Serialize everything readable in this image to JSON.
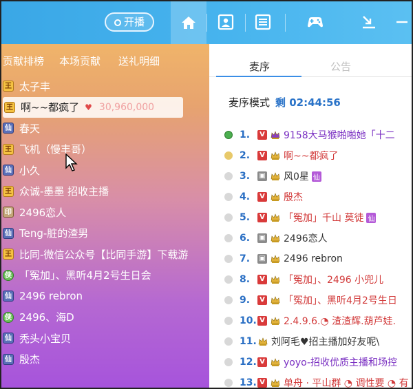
{
  "topbar": {
    "open_label": "开播",
    "icons": [
      "home-icon",
      "contact-card-icon",
      "list-icon",
      "gamepad-icon",
      "download-icon"
    ]
  },
  "left": {
    "tabs": [
      "贡献排榜",
      "本场贡献",
      "送礼明细"
    ],
    "rows": [
      {
        "badge": "王",
        "type": "king",
        "name": "太子丰"
      },
      {
        "badge": "王",
        "type": "king",
        "name": "啊~~都疯了",
        "amount": "30,960,000",
        "highlight": true
      },
      {
        "badge": "仙",
        "type": "shield",
        "name": "春天"
      },
      {
        "badge": "王",
        "type": "king",
        "name": "飞机（慢丰哥）"
      },
      {
        "badge": "仙",
        "type": "shield",
        "name": "小久"
      },
      {
        "badge": "王",
        "type": "king",
        "name": "众诚-墨墨 招收主播"
      },
      {
        "badge": "印",
        "type": "seal",
        "name": "2496恋人"
      },
      {
        "badge": "仙",
        "type": "shield",
        "name": "Teng-脏的渣男"
      },
      {
        "badge": "王",
        "type": "king",
        "name": "比同-微信公众号【比同手游】下载游"
      },
      {
        "badge": "侠",
        "type": "green",
        "name": "「冤加」、黑听4月2号生日会"
      },
      {
        "badge": "仙",
        "type": "shield",
        "name": "2496 rebron"
      },
      {
        "badge": "侠",
        "type": "green",
        "name": "2496、海D"
      },
      {
        "badge": "仙",
        "type": "shield",
        "name": "秃头小宝贝"
      },
      {
        "badge": "仙",
        "type": "shield",
        "name": "殷杰"
      }
    ]
  },
  "right": {
    "tabs": [
      "麦序",
      "公告"
    ],
    "mode_label": "麦序模式",
    "time_label": "剩 02:44:56",
    "rows": [
      {
        "num": "1.",
        "status": "active",
        "v": "V",
        "name": "9158大马猴啪啪她「十二",
        "color": "purple"
      },
      {
        "num": "2.",
        "status": "gold",
        "v": "V",
        "name": "啊~~都疯了",
        "color": "red"
      },
      {
        "num": "3.",
        "status": "none",
        "v": "▣",
        "name": "风0星",
        "color": "dark",
        "tag": "仙"
      },
      {
        "num": "4.",
        "status": "none",
        "v": "V",
        "name": "殷杰",
        "color": "red"
      },
      {
        "num": "5.",
        "status": "none",
        "v": "V",
        "name": "「冤加」千山 莫徒",
        "color": "red",
        "tag": "仙"
      },
      {
        "num": "6.",
        "status": "none",
        "v": "▣",
        "name": "2496恋人",
        "color": "dark"
      },
      {
        "num": "7.",
        "status": "none",
        "v": "▣",
        "name": "2496  rebron",
        "color": "dark"
      },
      {
        "num": "8.",
        "status": "none",
        "v": "V",
        "name": "「冤加」、2496 小兜儿",
        "color": "red"
      },
      {
        "num": "9.",
        "status": "none",
        "v": "V",
        "name": "「冤加」、黑听4月2号生日",
        "color": "red"
      },
      {
        "num": "10.",
        "status": "none",
        "v": "V",
        "name": "2.4.9.6.◔ 渣渣辉.葫芦娃.",
        "color": "red"
      },
      {
        "num": "11.",
        "status": "none",
        "v": "",
        "name": "刘阿毛♥招主播加好友呢\\",
        "color": "dark"
      },
      {
        "num": "12.",
        "status": "none",
        "v": "V",
        "name": "yoyo-招收优质主播和场控",
        "color": "purple"
      },
      {
        "num": "13.",
        "status": "none",
        "v": "V",
        "name": "单舟 · 平山群 ◔ 调性要 ◔ 有",
        "color": "red"
      }
    ]
  },
  "colors": {
    "topbar": "#47b4ee",
    "accent_blue": "#2a73c8",
    "red_name": "#d23a3a",
    "purple_name": "#7a2fc2"
  }
}
